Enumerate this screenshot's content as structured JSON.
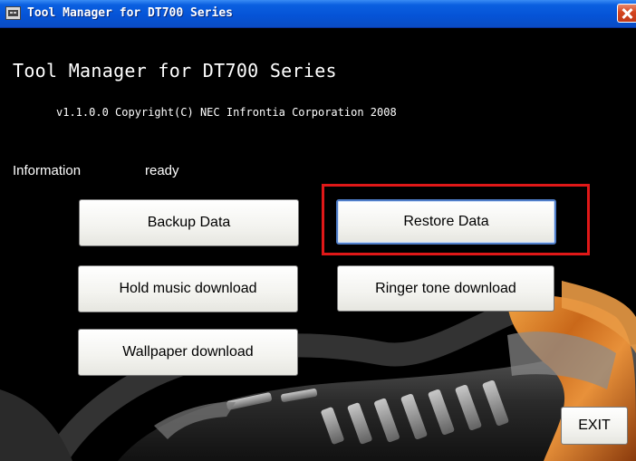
{
  "window": {
    "title": "Tool Manager for DT700 Series",
    "icon": "app-icon",
    "close_icon": "close-icon"
  },
  "header": {
    "heading": "Tool Manager for DT700 Series",
    "version": "v1.1.0.0 Copyright(C) NEC Infrontia Corporation 2008"
  },
  "info": {
    "label": "Information",
    "value": "ready"
  },
  "buttons": {
    "backup": "Backup Data",
    "restore": "Restore Data",
    "hold_music": "Hold music download",
    "ringer_tone": "Ringer tone download",
    "wallpaper": "Wallpaper download",
    "exit": "EXIT"
  },
  "colors": {
    "titlebar": "#0553d6",
    "background": "#000000",
    "highlight": "#e01818",
    "phone_wood": "#c9681a"
  }
}
